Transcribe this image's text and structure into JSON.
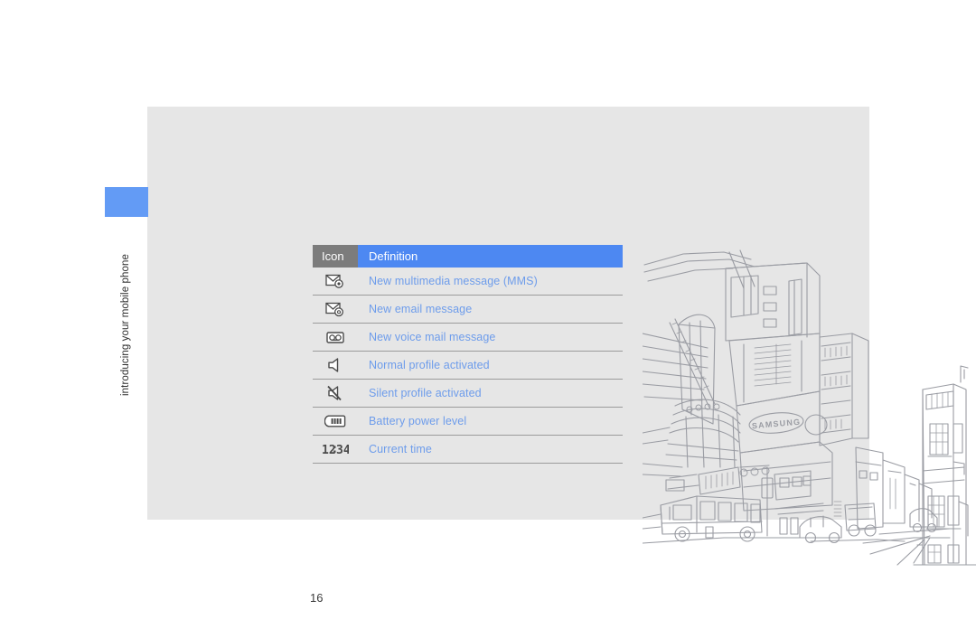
{
  "document": {
    "page_number": "16",
    "chapter_label": "introducing your mobile phone",
    "accent_color": "#4d88f2",
    "tab_color": "#639bf5",
    "header_icon_color": "#7c7c7c",
    "body_text_color": "#6d9ceb",
    "page_background": "#e6e6e6"
  },
  "table": {
    "headers": {
      "icon": "Icon",
      "definition": "Definition"
    },
    "rows": [
      {
        "icon_name": "mms-message-icon",
        "definition": "New multimedia message (MMS)"
      },
      {
        "icon_name": "email-message-icon",
        "definition": "New email message"
      },
      {
        "icon_name": "voice-mail-icon",
        "definition": "New voice mail message"
      },
      {
        "icon_name": "speaker-normal-profile-icon",
        "definition": "Normal profile activated"
      },
      {
        "icon_name": "speaker-muted-silent-profile-icon",
        "definition": "Silent profile activated"
      },
      {
        "icon_name": "battery-level-icon",
        "definition": "Battery power level"
      },
      {
        "icon_name": "clock-time-icon",
        "definition": "Current time"
      }
    ]
  },
  "illustration": {
    "name": "city-street-line-art",
    "building_sign_text": "SAMSUNG",
    "line_color": "#9a9ca3"
  }
}
